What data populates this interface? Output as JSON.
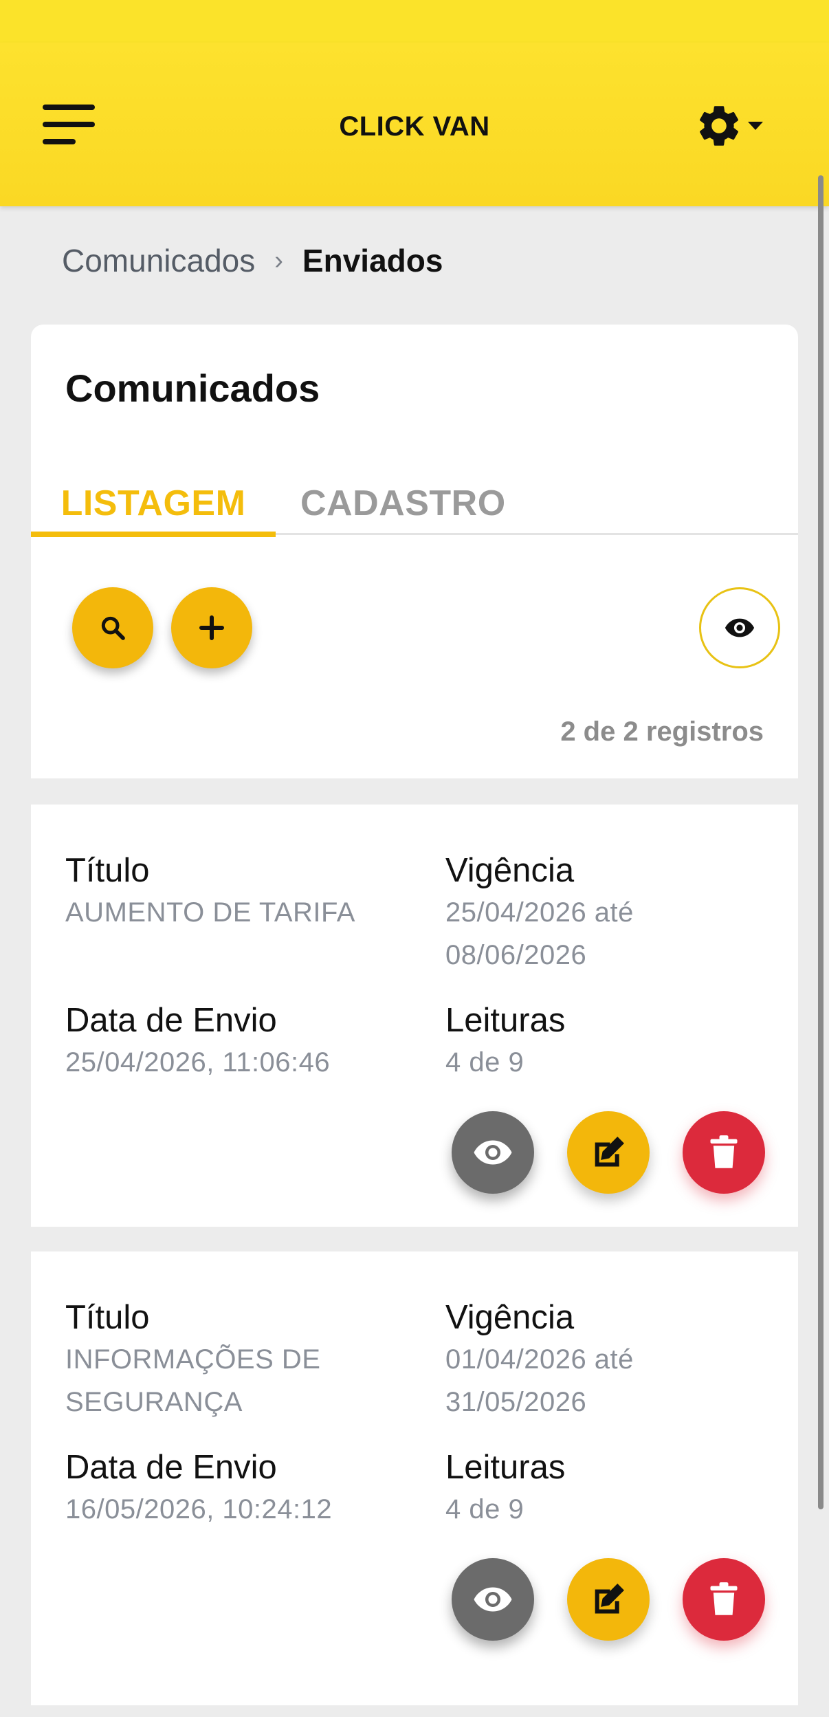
{
  "app": {
    "title": "CLICK VAN",
    "colors": {
      "primary": "#fde22e",
      "accent": "#f3b70b",
      "danger": "#dc2a3c",
      "muted": "#6b6b6b"
    }
  },
  "icons": {
    "menu": "menu-icon",
    "settings": "gear-icon",
    "search": "search-icon",
    "add": "plus-icon",
    "toggle_view": "eye-icon",
    "view": "eye-icon",
    "edit": "edit-icon",
    "delete": "trash-icon"
  },
  "breadcrumb": {
    "parent": "Comunicados",
    "separator": "›",
    "current": "Enviados"
  },
  "panel": {
    "title": "Comunicados",
    "tabs": [
      "LISTAGEM",
      "CADASTRO"
    ],
    "active_tab": "LISTAGEM",
    "records_text": "2 de 2 registros"
  },
  "labels": {
    "title": "Título",
    "validity": "Vigência",
    "sent_date": "Data de Envio",
    "reads": "Leituras"
  },
  "items": [
    {
      "title_lines": [
        "AUMENTO DE TARIFA"
      ],
      "validity_lines": [
        "25/04/2026 até",
        "08/06/2026"
      ],
      "sent_date": "25/04/2026, 11:06:46",
      "reads": "4 de 9"
    },
    {
      "title_lines": [
        "INFORMAÇÕES DE",
        "SEGURANÇA"
      ],
      "validity_lines": [
        "01/04/2026 até",
        "31/05/2026"
      ],
      "sent_date": "16/05/2026, 10:24:12",
      "reads": "4 de 9"
    }
  ]
}
